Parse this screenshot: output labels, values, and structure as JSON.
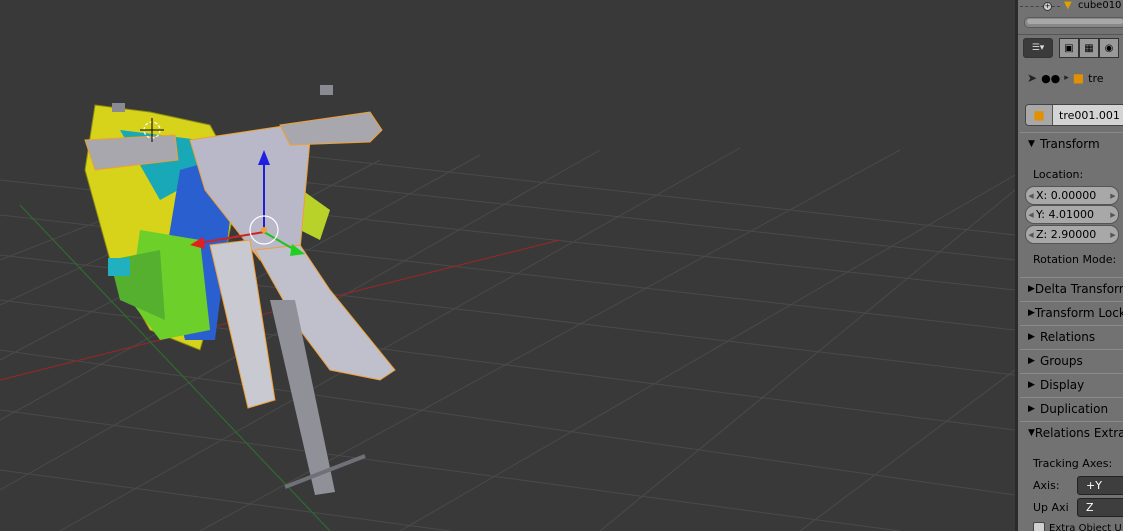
{
  "outliner": {
    "item_name": "cube010",
    "item_icon": "mesh-vertex-icon"
  },
  "properties_header": {
    "editor_menu_icon": "properties-editor-icon",
    "tabs": [
      "render-icon",
      "render-layers-icon",
      "scene-icon"
    ]
  },
  "breadcrumb": {
    "icons": [
      "pin-icon",
      "scene-link-icon",
      "object-icon"
    ],
    "object_name": "tre"
  },
  "object_name_field": {
    "value": "tre001.001"
  },
  "transform": {
    "title": "Transform",
    "location_label": "Location:",
    "x": "X:  0.00000",
    "y": "Y:  4.01000",
    "z": "Z:  2.90000",
    "rotation_mode_label": "Rotation Mode:"
  },
  "collapsed_panels": [
    "Delta Transform",
    "Transform Locks",
    "Relations",
    "Groups",
    "Display",
    "Duplication"
  ],
  "relations_extras": {
    "title": "Relations Extras",
    "tracking_axes_label": "Tracking Axes:",
    "axis_label": "Axis:",
    "axis_value": "+Y",
    "up_axis_label": "Up Axi",
    "up_axis_value": "Z",
    "checkbox_label": "Extra Object U"
  },
  "colors": {
    "viewport_bg": "#393939",
    "panel_bg": "#727272",
    "x_axis": "#8b2a2a",
    "y_axis": "#2e6b2e",
    "selection_outline": "#f0a030"
  }
}
